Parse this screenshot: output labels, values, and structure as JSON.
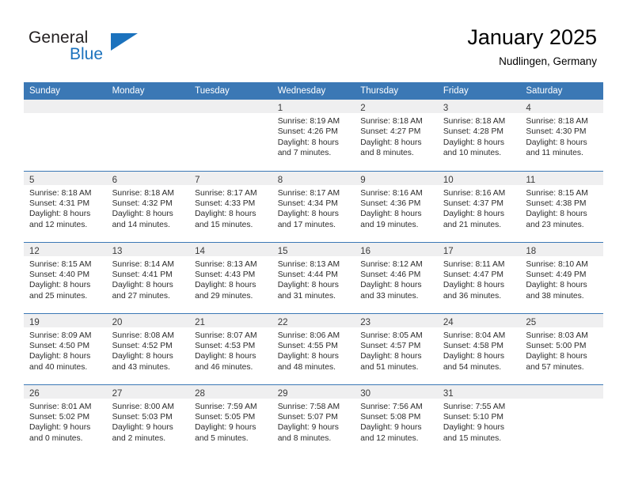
{
  "brand": {
    "name_part1": "General",
    "name_part2": "Blue",
    "logo_icon": "triangle-logo-icon",
    "accent_color": "#1b72bd"
  },
  "header": {
    "title": "January 2025",
    "subtitle": "Nudlingen, Germany",
    "header_bg_color": "#3b78b5",
    "daynum_band_color": "#efeff0"
  },
  "weekday_headers": [
    "Sunday",
    "Monday",
    "Tuesday",
    "Wednesday",
    "Thursday",
    "Friday",
    "Saturday"
  ],
  "weeks": [
    [
      {
        "empty": true
      },
      {
        "empty": true
      },
      {
        "empty": true
      },
      {
        "day": "1",
        "sunrise": "Sunrise: 8:19 AM",
        "sunset": "Sunset: 4:26 PM",
        "daylight1": "Daylight: 8 hours",
        "daylight2": "and 7 minutes."
      },
      {
        "day": "2",
        "sunrise": "Sunrise: 8:18 AM",
        "sunset": "Sunset: 4:27 PM",
        "daylight1": "Daylight: 8 hours",
        "daylight2": "and 8 minutes."
      },
      {
        "day": "3",
        "sunrise": "Sunrise: 8:18 AM",
        "sunset": "Sunset: 4:28 PM",
        "daylight1": "Daylight: 8 hours",
        "daylight2": "and 10 minutes."
      },
      {
        "day": "4",
        "sunrise": "Sunrise: 8:18 AM",
        "sunset": "Sunset: 4:30 PM",
        "daylight1": "Daylight: 8 hours",
        "daylight2": "and 11 minutes."
      }
    ],
    [
      {
        "day": "5",
        "sunrise": "Sunrise: 8:18 AM",
        "sunset": "Sunset: 4:31 PM",
        "daylight1": "Daylight: 8 hours",
        "daylight2": "and 12 minutes."
      },
      {
        "day": "6",
        "sunrise": "Sunrise: 8:18 AM",
        "sunset": "Sunset: 4:32 PM",
        "daylight1": "Daylight: 8 hours",
        "daylight2": "and 14 minutes."
      },
      {
        "day": "7",
        "sunrise": "Sunrise: 8:17 AM",
        "sunset": "Sunset: 4:33 PM",
        "daylight1": "Daylight: 8 hours",
        "daylight2": "and 15 minutes."
      },
      {
        "day": "8",
        "sunrise": "Sunrise: 8:17 AM",
        "sunset": "Sunset: 4:34 PM",
        "daylight1": "Daylight: 8 hours",
        "daylight2": "and 17 minutes."
      },
      {
        "day": "9",
        "sunrise": "Sunrise: 8:16 AM",
        "sunset": "Sunset: 4:36 PM",
        "daylight1": "Daylight: 8 hours",
        "daylight2": "and 19 minutes."
      },
      {
        "day": "10",
        "sunrise": "Sunrise: 8:16 AM",
        "sunset": "Sunset: 4:37 PM",
        "daylight1": "Daylight: 8 hours",
        "daylight2": "and 21 minutes."
      },
      {
        "day": "11",
        "sunrise": "Sunrise: 8:15 AM",
        "sunset": "Sunset: 4:38 PM",
        "daylight1": "Daylight: 8 hours",
        "daylight2": "and 23 minutes."
      }
    ],
    [
      {
        "day": "12",
        "sunrise": "Sunrise: 8:15 AM",
        "sunset": "Sunset: 4:40 PM",
        "daylight1": "Daylight: 8 hours",
        "daylight2": "and 25 minutes."
      },
      {
        "day": "13",
        "sunrise": "Sunrise: 8:14 AM",
        "sunset": "Sunset: 4:41 PM",
        "daylight1": "Daylight: 8 hours",
        "daylight2": "and 27 minutes."
      },
      {
        "day": "14",
        "sunrise": "Sunrise: 8:13 AM",
        "sunset": "Sunset: 4:43 PM",
        "daylight1": "Daylight: 8 hours",
        "daylight2": "and 29 minutes."
      },
      {
        "day": "15",
        "sunrise": "Sunrise: 8:13 AM",
        "sunset": "Sunset: 4:44 PM",
        "daylight1": "Daylight: 8 hours",
        "daylight2": "and 31 minutes."
      },
      {
        "day": "16",
        "sunrise": "Sunrise: 8:12 AM",
        "sunset": "Sunset: 4:46 PM",
        "daylight1": "Daylight: 8 hours",
        "daylight2": "and 33 minutes."
      },
      {
        "day": "17",
        "sunrise": "Sunrise: 8:11 AM",
        "sunset": "Sunset: 4:47 PM",
        "daylight1": "Daylight: 8 hours",
        "daylight2": "and 36 minutes."
      },
      {
        "day": "18",
        "sunrise": "Sunrise: 8:10 AM",
        "sunset": "Sunset: 4:49 PM",
        "daylight1": "Daylight: 8 hours",
        "daylight2": "and 38 minutes."
      }
    ],
    [
      {
        "day": "19",
        "sunrise": "Sunrise: 8:09 AM",
        "sunset": "Sunset: 4:50 PM",
        "daylight1": "Daylight: 8 hours",
        "daylight2": "and 40 minutes."
      },
      {
        "day": "20",
        "sunrise": "Sunrise: 8:08 AM",
        "sunset": "Sunset: 4:52 PM",
        "daylight1": "Daylight: 8 hours",
        "daylight2": "and 43 minutes."
      },
      {
        "day": "21",
        "sunrise": "Sunrise: 8:07 AM",
        "sunset": "Sunset: 4:53 PM",
        "daylight1": "Daylight: 8 hours",
        "daylight2": "and 46 minutes."
      },
      {
        "day": "22",
        "sunrise": "Sunrise: 8:06 AM",
        "sunset": "Sunset: 4:55 PM",
        "daylight1": "Daylight: 8 hours",
        "daylight2": "and 48 minutes."
      },
      {
        "day": "23",
        "sunrise": "Sunrise: 8:05 AM",
        "sunset": "Sunset: 4:57 PM",
        "daylight1": "Daylight: 8 hours",
        "daylight2": "and 51 minutes."
      },
      {
        "day": "24",
        "sunrise": "Sunrise: 8:04 AM",
        "sunset": "Sunset: 4:58 PM",
        "daylight1": "Daylight: 8 hours",
        "daylight2": "and 54 minutes."
      },
      {
        "day": "25",
        "sunrise": "Sunrise: 8:03 AM",
        "sunset": "Sunset: 5:00 PM",
        "daylight1": "Daylight: 8 hours",
        "daylight2": "and 57 minutes."
      }
    ],
    [
      {
        "day": "26",
        "sunrise": "Sunrise: 8:01 AM",
        "sunset": "Sunset: 5:02 PM",
        "daylight1": "Daylight: 9 hours",
        "daylight2": "and 0 minutes."
      },
      {
        "day": "27",
        "sunrise": "Sunrise: 8:00 AM",
        "sunset": "Sunset: 5:03 PM",
        "daylight1": "Daylight: 9 hours",
        "daylight2": "and 2 minutes."
      },
      {
        "day": "28",
        "sunrise": "Sunrise: 7:59 AM",
        "sunset": "Sunset: 5:05 PM",
        "daylight1": "Daylight: 9 hours",
        "daylight2": "and 5 minutes."
      },
      {
        "day": "29",
        "sunrise": "Sunrise: 7:58 AM",
        "sunset": "Sunset: 5:07 PM",
        "daylight1": "Daylight: 9 hours",
        "daylight2": "and 8 minutes."
      },
      {
        "day": "30",
        "sunrise": "Sunrise: 7:56 AM",
        "sunset": "Sunset: 5:08 PM",
        "daylight1": "Daylight: 9 hours",
        "daylight2": "and 12 minutes."
      },
      {
        "day": "31",
        "sunrise": "Sunrise: 7:55 AM",
        "sunset": "Sunset: 5:10 PM",
        "daylight1": "Daylight: 9 hours",
        "daylight2": "and 15 minutes."
      },
      {
        "empty": true
      }
    ]
  ]
}
